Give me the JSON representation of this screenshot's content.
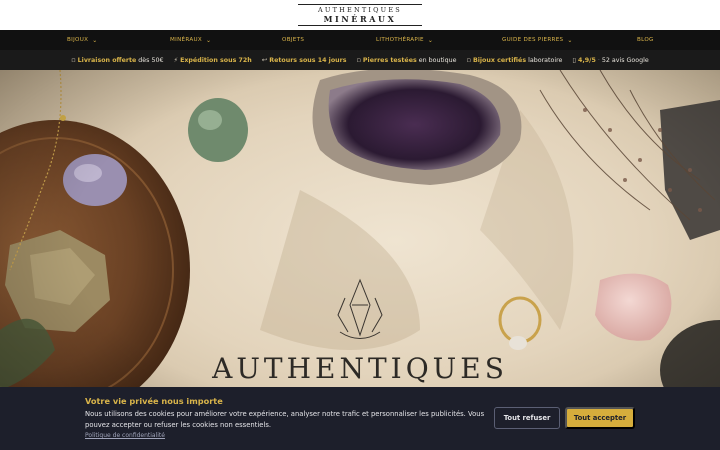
{
  "brand": {
    "line1": "AUTHENTIQUES",
    "line2": "MINÉRAUX"
  },
  "nav": [
    {
      "label": "BIJOUX",
      "chevron": true
    },
    {
      "label": "MINÉRAUX",
      "chevron": true
    },
    {
      "label": "OBJETS",
      "chevron": false
    },
    {
      "label": "LITHOTHÉRAPIE",
      "chevron": true
    },
    {
      "label": "GUIDE DES PIERRES",
      "chevron": true
    },
    {
      "label": "BLOG",
      "chevron": false
    }
  ],
  "strip": {
    "shipping_bold": "Livraison offerte",
    "shipping_rest": "dès 50€",
    "dispatch": "Expédition sous 72h",
    "returns": "Retours sous 14 jours",
    "tested_bold": "Pierres testées",
    "tested_rest": "en boutique",
    "certified_bold": "Bijoux certifiés",
    "certified_rest": "laboratoire",
    "rating": "4,9/5",
    "reviews": "52 avis Google"
  },
  "hero": {
    "word": "AUTHENTIQUES"
  },
  "cookie": {
    "title": "Votre vie privée nous importe",
    "text": "Nous utilisons des cookies pour améliorer votre expérience, analyser notre trafic et personnaliser les publicités. Vous pouvez accepter ou refuser les cookies non essentiels.",
    "link": "Politique de confidentialité",
    "refuse": "Tout refuser",
    "accept": "Tout accepter"
  },
  "colors": {
    "accent": "#d9b44a",
    "nav_bg": "#111111",
    "banner_bg": "#1d1f2b"
  }
}
